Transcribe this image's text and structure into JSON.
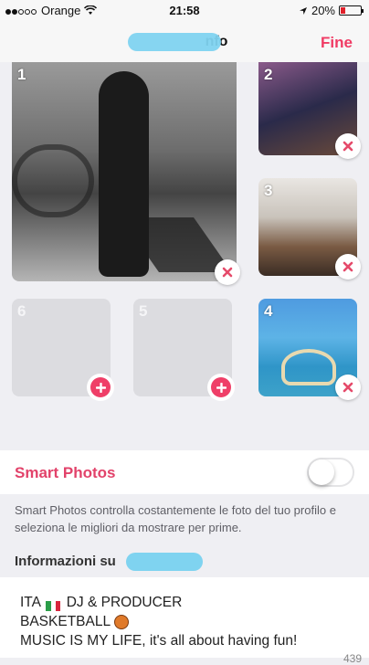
{
  "status": {
    "carrier": "Orange",
    "time": "21:58",
    "battery": "20%"
  },
  "nav": {
    "title": "nfo",
    "done_label": "Fine"
  },
  "photos": [
    {
      "num": "1"
    },
    {
      "num": "2"
    },
    {
      "num": "3"
    },
    {
      "num": "4"
    },
    {
      "num": "5"
    },
    {
      "num": "6"
    }
  ],
  "smart": {
    "label": "Smart Photos",
    "enabled": false,
    "description": "Smart Photos controlla costantemente le foto del tuo profilo e seleziona le migliori da mostrare per prime."
  },
  "about": {
    "title": "Informazioni su"
  },
  "bio": {
    "line1_a": "ITA",
    "line1_b": "DJ & PRODUCER",
    "line2": "BASKETBALL",
    "line3": "MUSIC IS MY LIFE, it's all about having fun!"
  },
  "counter": "439",
  "colors": {
    "accent": "#f03b64",
    "remove": "#e54a6a"
  }
}
